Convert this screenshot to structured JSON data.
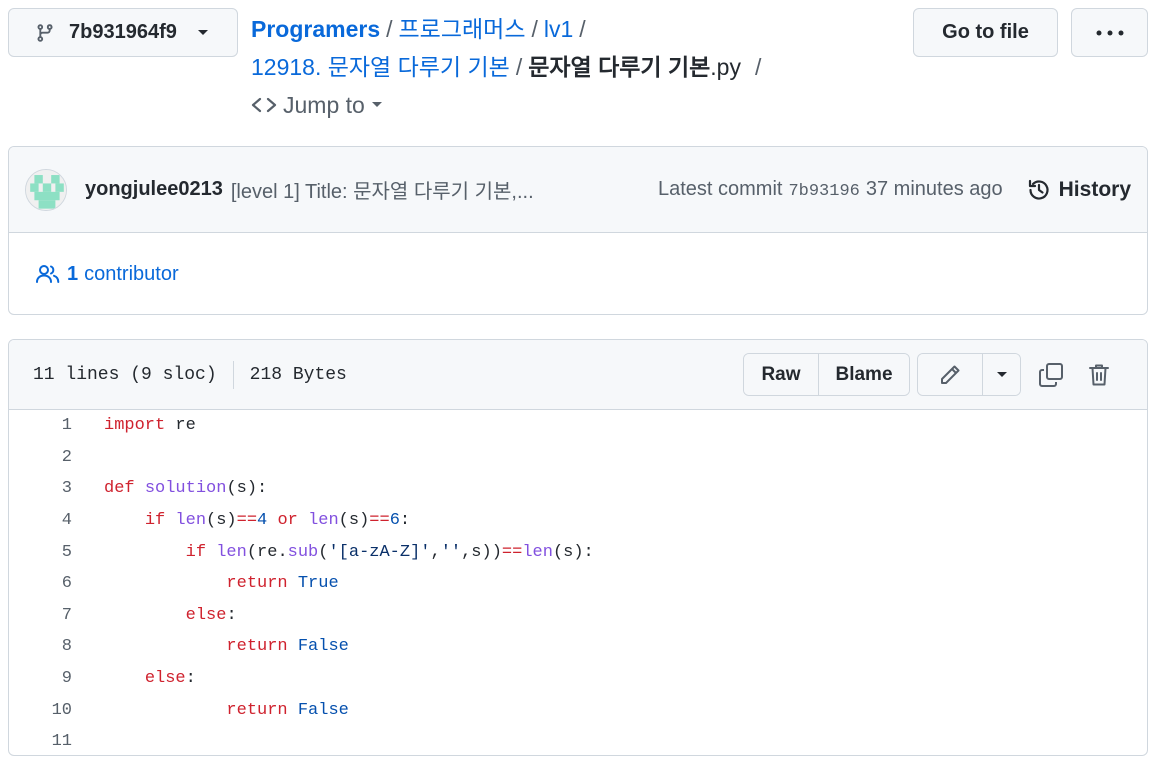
{
  "header": {
    "branch": "7b931964f9",
    "breadcrumb": {
      "repo": "Programers",
      "dir1": "프로그래머스",
      "dir2": "lv1",
      "dir3": "12918. 문자열 다루기 기본",
      "file_name": "문자열 다루기 기본",
      "file_ext": ".py",
      "sep": "/"
    },
    "jump_to": "Jump to",
    "go_to_file": "Go to file",
    "more": "···"
  },
  "commit": {
    "author": "yongjulee0213",
    "message": "[level 1] Title: 문자열 다루기 기본,...",
    "latest_label": "Latest commit",
    "sha": "7b93196",
    "time": "37 minutes ago",
    "history_label": "History",
    "contributor_count": "1",
    "contributor_label": "contributor"
  },
  "file": {
    "lines_info": "11 lines (9 sloc)",
    "size": "218 Bytes",
    "raw_label": "Raw",
    "blame_label": "Blame"
  },
  "code": [
    {
      "n": "1",
      "tokens": [
        {
          "t": "import",
          "c": "kw"
        },
        {
          "t": " re",
          "c": ""
        }
      ]
    },
    {
      "n": "2",
      "tokens": []
    },
    {
      "n": "3",
      "tokens": [
        {
          "t": "def",
          "c": "kw"
        },
        {
          "t": " ",
          "c": ""
        },
        {
          "t": "solution",
          "c": "fn"
        },
        {
          "t": "(s):",
          "c": ""
        }
      ]
    },
    {
      "n": "4",
      "tokens": [
        {
          "t": "    ",
          "c": ""
        },
        {
          "t": "if",
          "c": "kw"
        },
        {
          "t": " ",
          "c": ""
        },
        {
          "t": "len",
          "c": "fn"
        },
        {
          "t": "(s)",
          "c": ""
        },
        {
          "t": "==",
          "c": "kw"
        },
        {
          "t": "4",
          "c": "bi"
        },
        {
          "t": " ",
          "c": ""
        },
        {
          "t": "or",
          "c": "kw"
        },
        {
          "t": " ",
          "c": ""
        },
        {
          "t": "len",
          "c": "fn"
        },
        {
          "t": "(s)",
          "c": ""
        },
        {
          "t": "==",
          "c": "kw"
        },
        {
          "t": "6",
          "c": "bi"
        },
        {
          "t": ":",
          "c": ""
        }
      ]
    },
    {
      "n": "5",
      "tokens": [
        {
          "t": "        ",
          "c": ""
        },
        {
          "t": "if",
          "c": "kw"
        },
        {
          "t": " ",
          "c": ""
        },
        {
          "t": "len",
          "c": "fn"
        },
        {
          "t": "(re.",
          "c": ""
        },
        {
          "t": "sub",
          "c": "fn"
        },
        {
          "t": "(",
          "c": ""
        },
        {
          "t": "'[a-zA-Z]'",
          "c": "st"
        },
        {
          "t": ",",
          "c": ""
        },
        {
          "t": "''",
          "c": "st"
        },
        {
          "t": ",s))",
          "c": ""
        },
        {
          "t": "==",
          "c": "kw"
        },
        {
          "t": "len",
          "c": "fn"
        },
        {
          "t": "(s):",
          "c": ""
        }
      ]
    },
    {
      "n": "6",
      "tokens": [
        {
          "t": "            ",
          "c": ""
        },
        {
          "t": "return",
          "c": "kw"
        },
        {
          "t": " ",
          "c": ""
        },
        {
          "t": "True",
          "c": "bi"
        }
      ]
    },
    {
      "n": "7",
      "tokens": [
        {
          "t": "        ",
          "c": ""
        },
        {
          "t": "else",
          "c": "kw"
        },
        {
          "t": ":",
          "c": ""
        }
      ]
    },
    {
      "n": "8",
      "tokens": [
        {
          "t": "            ",
          "c": ""
        },
        {
          "t": "return",
          "c": "kw"
        },
        {
          "t": " ",
          "c": ""
        },
        {
          "t": "False",
          "c": "bi"
        }
      ]
    },
    {
      "n": "9",
      "tokens": [
        {
          "t": "    ",
          "c": ""
        },
        {
          "t": "else",
          "c": "kw"
        },
        {
          "t": ":",
          "c": ""
        }
      ]
    },
    {
      "n": "10",
      "tokens": [
        {
          "t": "            ",
          "c": ""
        },
        {
          "t": "return",
          "c": "kw"
        },
        {
          "t": " ",
          "c": ""
        },
        {
          "t": "False",
          "c": "bi"
        }
      ]
    },
    {
      "n": "11",
      "tokens": []
    }
  ],
  "colors": {
    "link": "#0969da",
    "keyword": "#cf222e",
    "function": "#8250df",
    "builtin": "#0550ae",
    "string": "#0a3069"
  },
  "icons": [
    "git-branch-icon",
    "caret-down-icon",
    "code-icon",
    "kebab-horizontal-icon",
    "avatar-identicon",
    "history-icon",
    "people-icon",
    "pencil-icon",
    "copy-icon",
    "trash-icon"
  ]
}
